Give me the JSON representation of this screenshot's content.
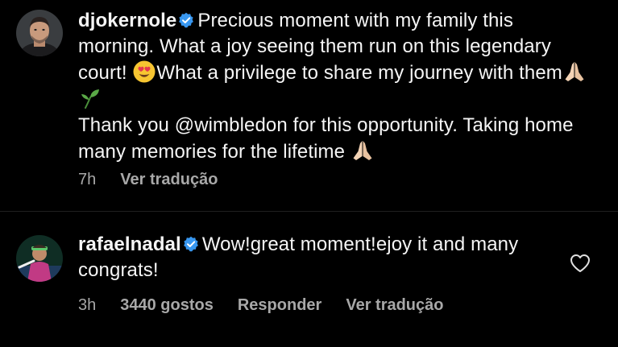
{
  "comments": [
    {
      "username": "djokernole",
      "verified": true,
      "text_parts": [
        "Precious moment with my family this morning. What a joy seeing them run on this legendary court! ",
        "What a privilege to share my journey with them",
        "Thank you @wimbledon for this opportunity. Taking home many memories for the lifetime "
      ],
      "emojis": [
        "heart-eyes-emoji",
        "folded-hands-emoji",
        "seedling-emoji",
        "folded-hands-emoji"
      ],
      "time": "7h",
      "translate_label": "Ver tradução"
    },
    {
      "username": "rafaelnadal",
      "verified": true,
      "text": "Wow!great moment!ejoy it and many congrats!",
      "time": "3h",
      "likes_label": "3440 gostos",
      "reply_label": "Responder",
      "translate_label": "Ver tradução",
      "like_icon": "heart-outline-icon"
    }
  ],
  "colors": {
    "background": "#000000",
    "text": "#f5f5f5",
    "meta": "#a8a8a8",
    "verified": "#3897f0"
  }
}
